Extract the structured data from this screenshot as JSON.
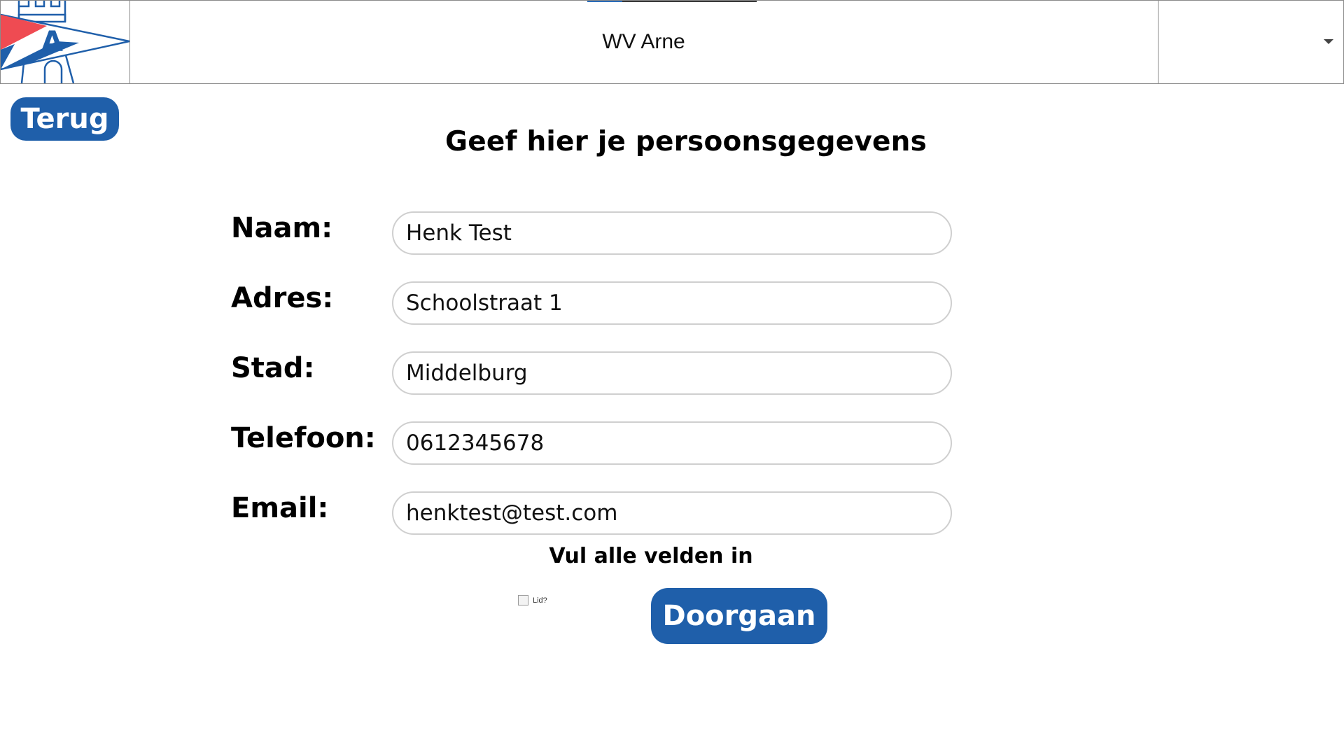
{
  "header": {
    "title": "WV Arne",
    "logo_letter": "A",
    "dropdown_value": "",
    "dropdown_icon": "chevron-down-icon"
  },
  "back_button": {
    "label": "Terug"
  },
  "page_title": "Geef hier je persoonsgegevens",
  "form": {
    "fields": [
      {
        "label": "Naam:",
        "value": "Henk Test"
      },
      {
        "label": "Adres:",
        "value": "Schoolstraat 1"
      },
      {
        "label": "Stad:",
        "value": "Middelburg"
      },
      {
        "label": "Telefoon:",
        "value": "0612345678"
      },
      {
        "label": "Email:",
        "value": "henktest@test.com"
      }
    ],
    "validation_message": "Vul alle velden in",
    "member_checkbox": {
      "label": "Lid?",
      "checked": false
    },
    "submit_label": "Doorgaan"
  },
  "colors": {
    "accent": "#1f5faa",
    "logo_red": "#ef4b52",
    "logo_blue": "#1f5faa"
  }
}
